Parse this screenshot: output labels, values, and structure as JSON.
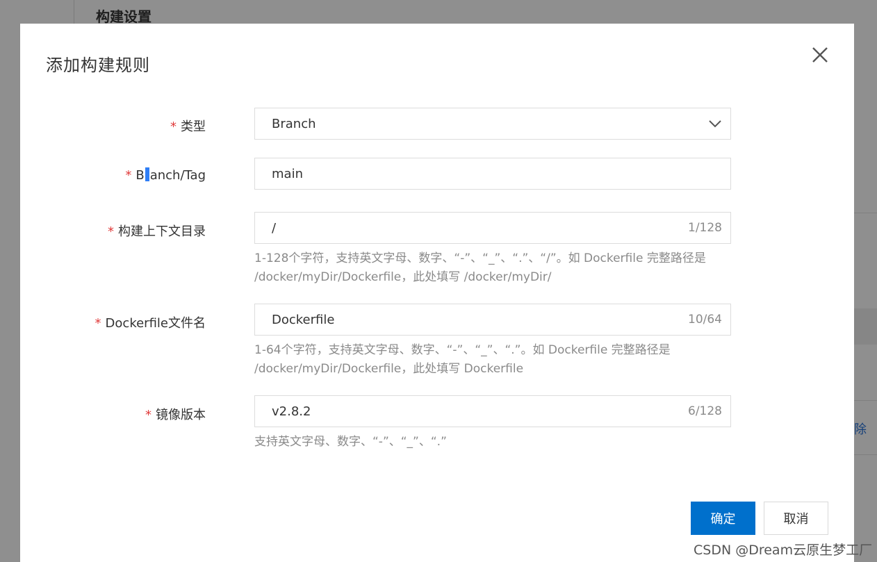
{
  "background": {
    "section_title": "构建设置",
    "delete_partial": "除"
  },
  "dialog": {
    "title": "添加构建规则",
    "close_icon": "close-icon"
  },
  "form": {
    "type": {
      "label": "类型",
      "required_mark": "*",
      "value": "Branch"
    },
    "branch_tag": {
      "label_prefix": "B",
      "label_suffix": "anch/Tag",
      "required_mark": "*",
      "value": "main"
    },
    "context_dir": {
      "label": "构建上下文目录",
      "required_mark": "*",
      "value": "/",
      "counter": "1/128",
      "hint_line1": "1-128个字符，支持英文字母、数字、“-”、“_”、“.”、“/”。如 Dockerfile 完整路径是",
      "hint_line2": "/docker/myDir/Dockerfile，此处填写 /docker/myDir/"
    },
    "dockerfile_name": {
      "label": "Dockerfile文件名",
      "required_mark": "*",
      "value": "Dockerfile",
      "counter": "10/64",
      "hint_line1": "1-64个字符，支持英文字母、数字、“-”、“_”、“.”。如 Dockerfile 完整路径是",
      "hint_line2": "/docker/myDir/Dockerfile，此处填写 Dockerfile"
    },
    "image_version": {
      "label": "镜像版本",
      "required_mark": "*",
      "value": "v2.8.2",
      "counter": "6/128",
      "hint_line1": "支持英文字母、数字、“-”、“_”、“.”"
    }
  },
  "buttons": {
    "confirm": "确定",
    "cancel": "取消"
  },
  "watermark": "CSDN @Dream云原生梦工厂",
  "colors": {
    "primary": "#0070cc",
    "required": "#e03a3a",
    "hint": "#8a8a8a"
  }
}
